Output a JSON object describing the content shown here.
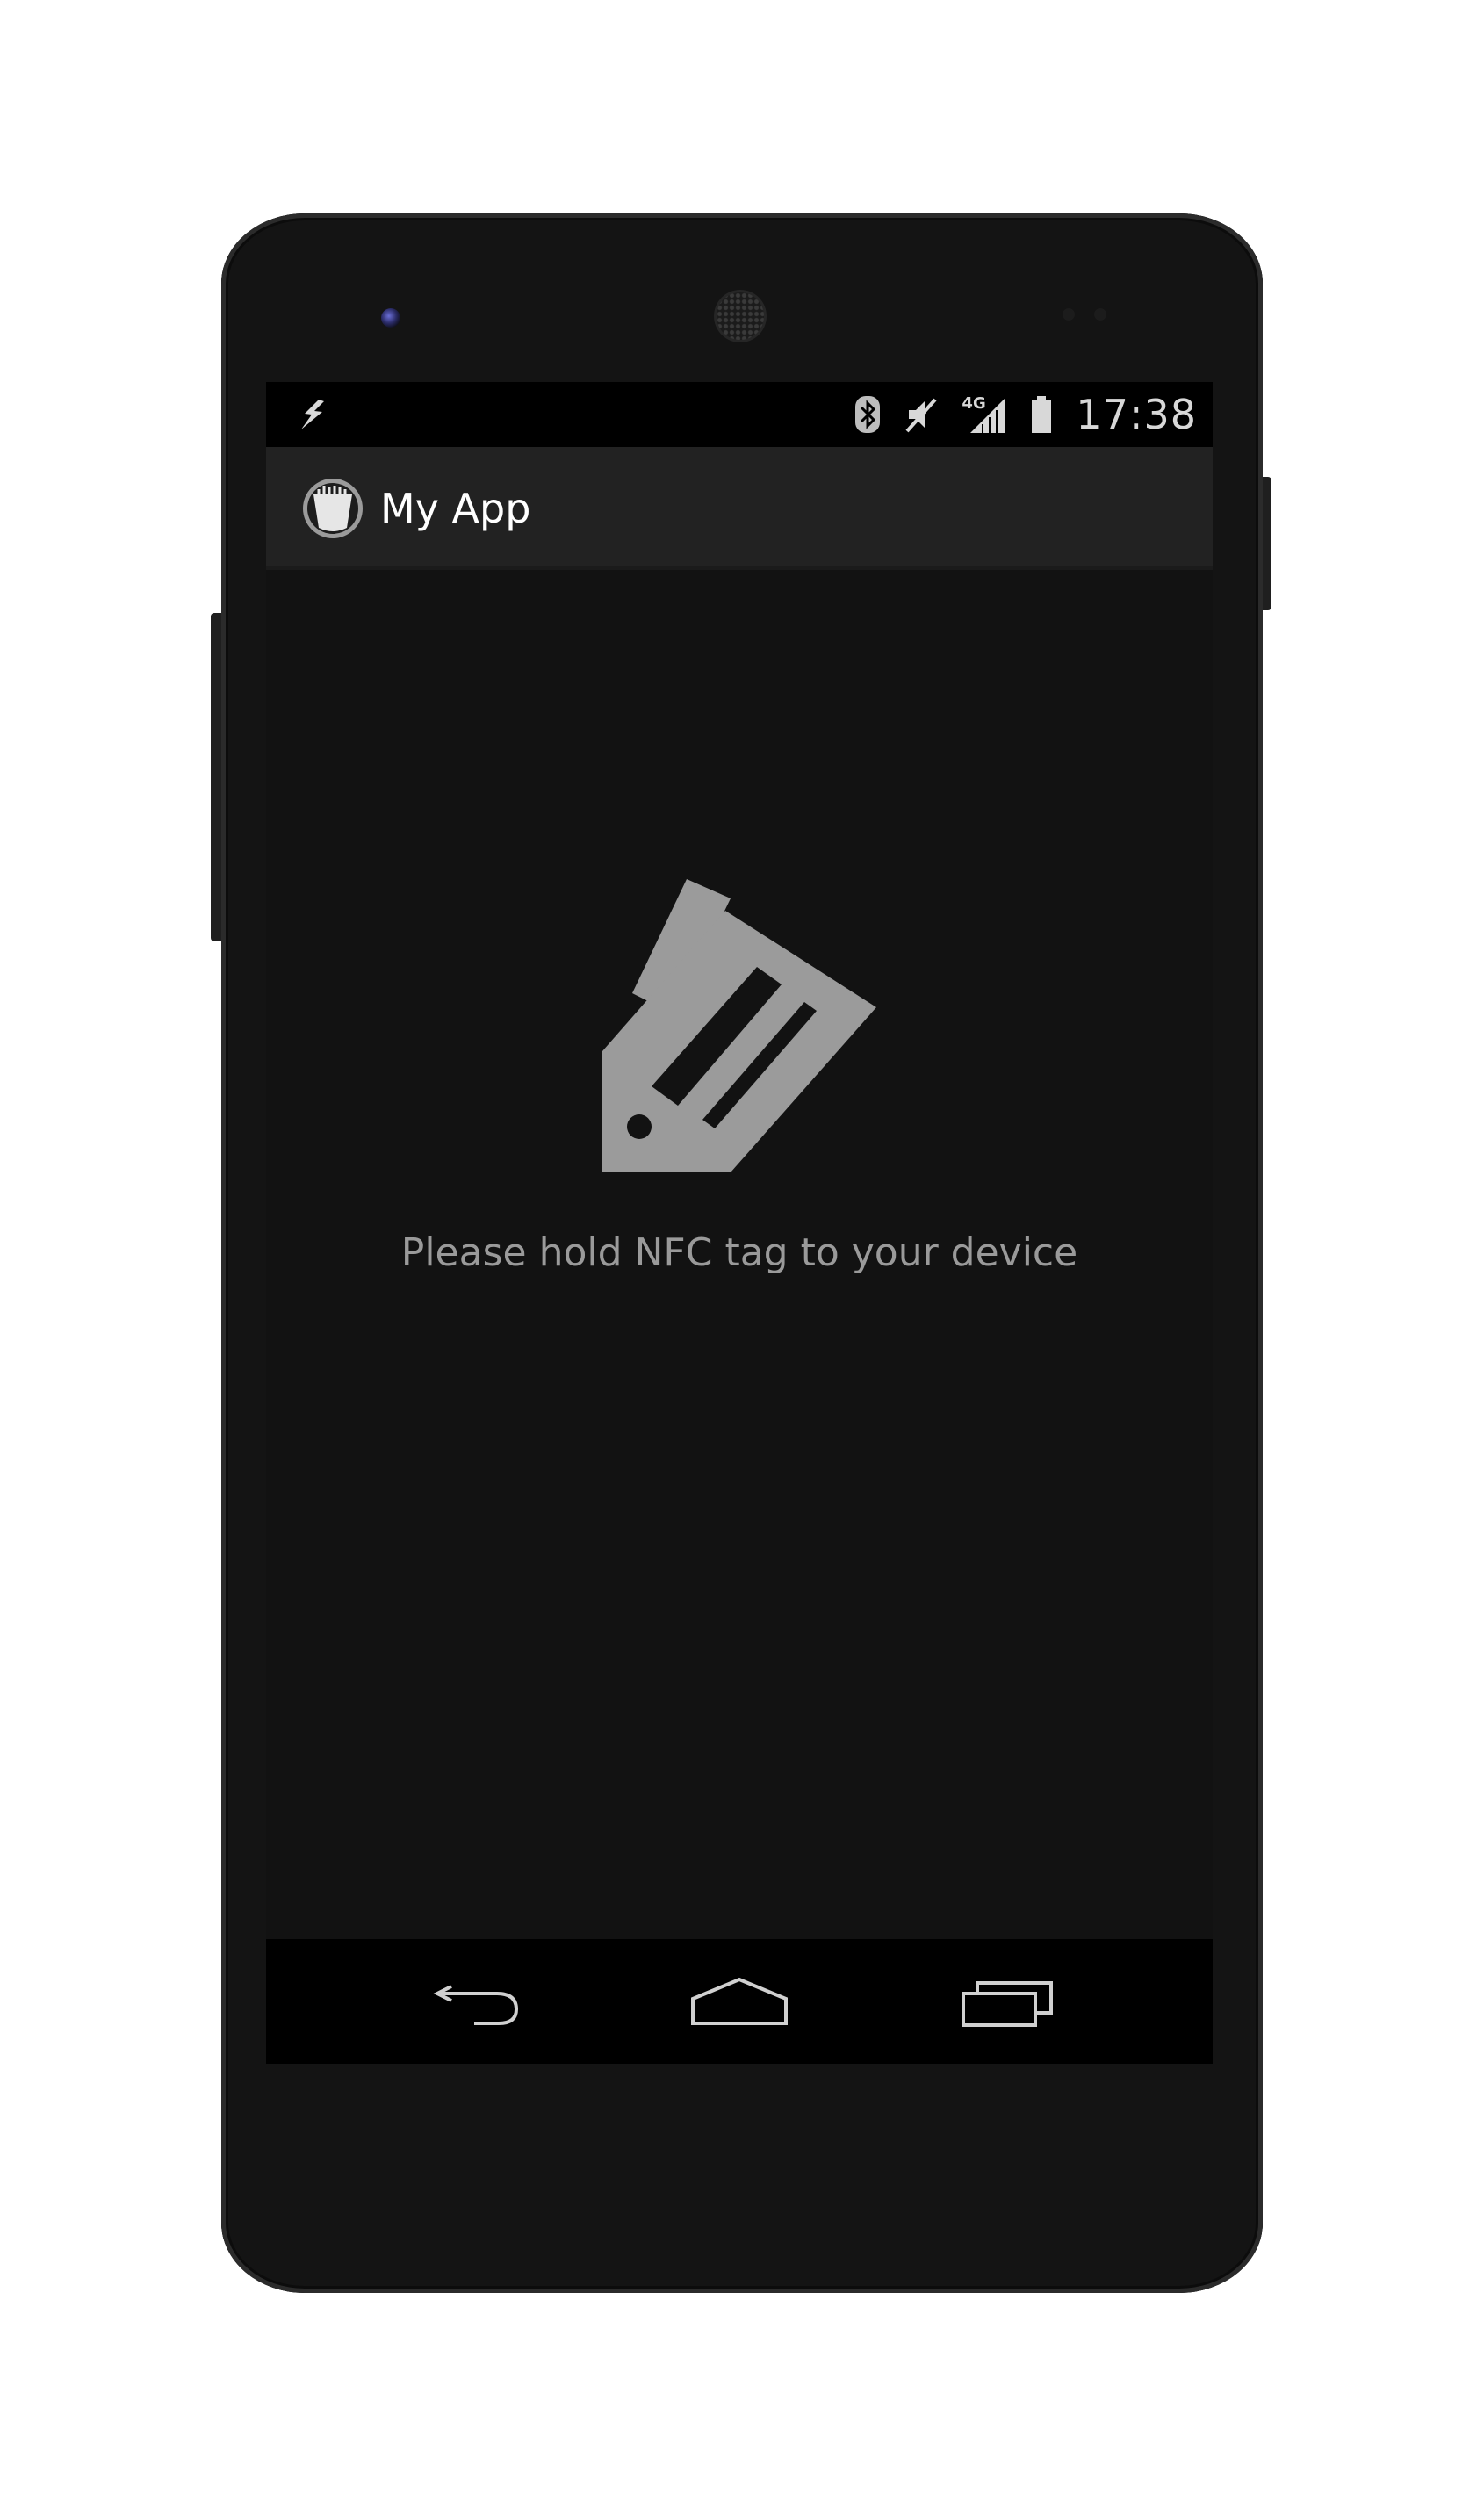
{
  "status_bar": {
    "time": "17:38",
    "network_label": "4G",
    "icons": [
      "flash-icon",
      "bluetooth-icon",
      "mute-icon",
      "signal-icon",
      "battery-icon"
    ]
  },
  "action_bar": {
    "title": "My App",
    "app_icon": "app-logo-icon"
  },
  "content": {
    "icon": "nfc-tag-icon",
    "message": "Please hold NFC tag to your device"
  },
  "nav_bar": {
    "buttons": [
      "back",
      "home",
      "recents"
    ]
  },
  "colors": {
    "screen_background": "#121212",
    "action_bar": "#222222",
    "status_bar": "#000000",
    "icon_gray": "#9b9b9b",
    "message_text": "#9a9a9a"
  }
}
